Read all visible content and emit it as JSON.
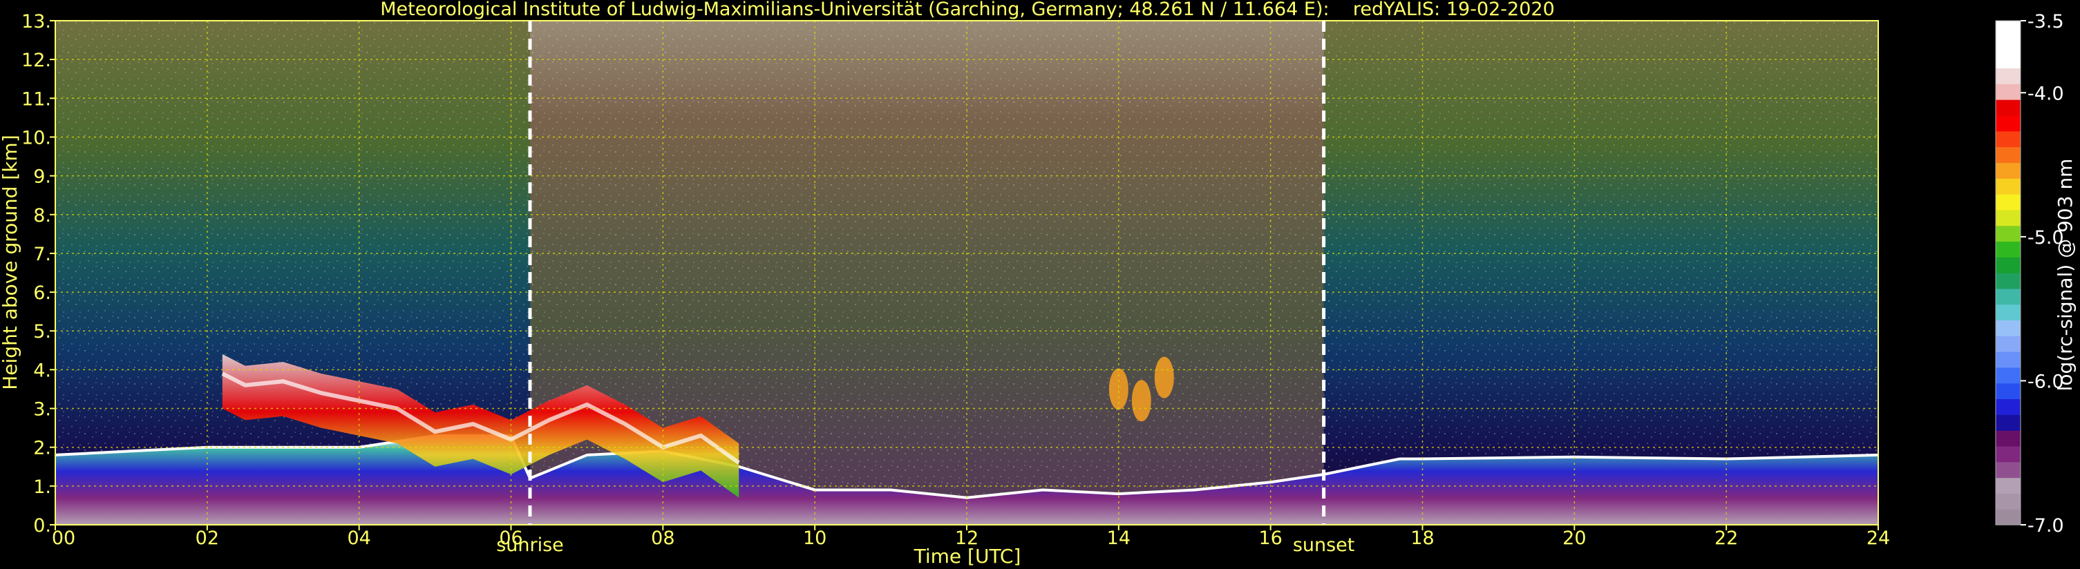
{
  "chart_data": {
    "type": "heatmap",
    "title": "Meteorological Institute of Ludwig-Maximilians-Universität (Garching, Germany; 48.261 N / 11.664 E):    redYALIS: 19-02-2020",
    "xlabel": "Time [UTC]",
    "ylabel": "Height above ground [km]",
    "xlim": [
      0,
      24
    ],
    "ylim": [
      0,
      13
    ],
    "x_ticks": [
      0,
      2,
      4,
      6,
      8,
      10,
      12,
      14,
      16,
      18,
      20,
      22,
      24
    ],
    "x_tick_labels": [
      "00",
      "02",
      "04",
      "06",
      "08",
      "10",
      "12",
      "14",
      "16",
      "18",
      "20",
      "22",
      "24"
    ],
    "y_ticks": [
      0,
      1,
      2,
      3,
      4,
      5,
      6,
      7,
      8,
      9,
      10,
      11,
      12,
      13
    ],
    "y_tick_labels": [
      "0.",
      "1.",
      "2.",
      "3.",
      "4.",
      "5.",
      "6.",
      "7.",
      "8.",
      "9.",
      "10.",
      "11.",
      "12.",
      "13."
    ],
    "grid": true,
    "colorbar": {
      "label": "log(rc-signal) @ 903 nm",
      "range": [
        -7.0,
        -3.5
      ],
      "tick_values": [
        -3.5,
        -4.0,
        -5.0,
        -6.0,
        -7.0
      ],
      "tick_labels": [
        "-3.5",
        "-4.0",
        "-5.0",
        "-6.0",
        "-7.0"
      ],
      "colors": [
        "#9c8c9c",
        "#a896a8",
        "#b4a0b4",
        "#905090",
        "#802880",
        "#681068",
        "#1810a0",
        "#2020d8",
        "#2850f0",
        "#4070f8",
        "#6890f8",
        "#88a8f8",
        "#98c0f8",
        "#60c8d0",
        "#40b8a8",
        "#20a060",
        "#18a030",
        "#30b820",
        "#80d020",
        "#d8e820",
        "#f8f020",
        "#f8d020",
        "#f8a020",
        "#f87018",
        "#f84010",
        "#f80000",
        "#e80000",
        "#f0b8b8",
        "#f0d8d8",
        "#ffffff",
        "#ffffff",
        "#ffffff"
      ]
    },
    "annotations": [
      {
        "label": "sunrise",
        "x": 6.25
      },
      {
        "label": "sunset",
        "x": 16.7
      }
    ],
    "layers": {
      "boundary_layer_top": [
        [
          0,
          1.8
        ],
        [
          1,
          1.9
        ],
        [
          2,
          2.0
        ],
        [
          2.5,
          2.0
        ],
        [
          3,
          2.0
        ],
        [
          4,
          2.0
        ],
        [
          5,
          2.3
        ],
        [
          6,
          2.3
        ],
        [
          6.25,
          1.2
        ],
        [
          7,
          1.8
        ],
        [
          8,
          1.9
        ],
        [
          9,
          1.5
        ],
        [
          10,
          0.9
        ],
        [
          11,
          0.9
        ],
        [
          12,
          0.7
        ],
        [
          13,
          0.9
        ],
        [
          14,
          0.8
        ],
        [
          15,
          0.9
        ],
        [
          16,
          1.1
        ],
        [
          16.7,
          1.3
        ],
        [
          17.7,
          1.7
        ],
        [
          18,
          1.7
        ],
        [
          20,
          1.75
        ],
        [
          22,
          1.7
        ],
        [
          24,
          1.8
        ]
      ],
      "elevated_aerosol_layer": [
        [
          2.2,
          3.9
        ],
        [
          2.5,
          3.6
        ],
        [
          3,
          3.7
        ],
        [
          3.5,
          3.4
        ],
        [
          4,
          3.2
        ],
        [
          4.5,
          3.0
        ],
        [
          5,
          2.4
        ],
        [
          5.5,
          2.6
        ],
        [
          6,
          2.2
        ],
        [
          6.5,
          2.7
        ],
        [
          7,
          3.1
        ],
        [
          7.5,
          2.6
        ],
        [
          8,
          2.0
        ],
        [
          8.5,
          2.3
        ],
        [
          9,
          1.6
        ]
      ],
      "cloud_patches": [
        [
          14.0,
          3.5
        ],
        [
          14.3,
          3.2
        ],
        [
          14.6,
          3.8
        ]
      ],
      "noisy_daytime_region": [
        6.25,
        16.7
      ]
    }
  }
}
